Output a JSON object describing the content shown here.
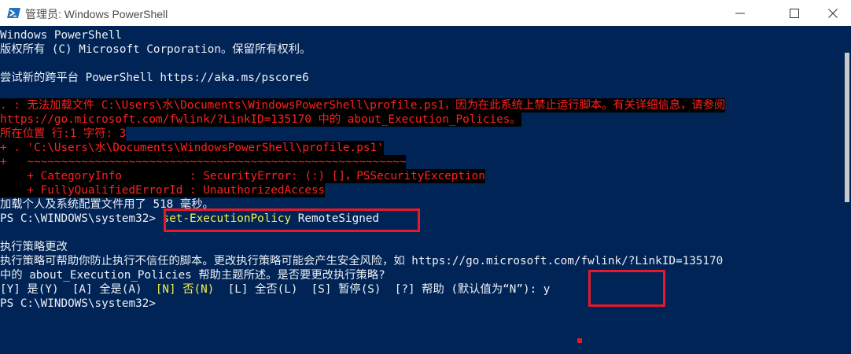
{
  "window": {
    "title": "管理员: Windows PowerShell"
  },
  "console": {
    "line1": "Windows PowerShell",
    "line2": "版权所有 (C) Microsoft Corporation。保留所有权利。",
    "line3": "尝试新的跨平台 PowerShell https://aka.ms/pscore6",
    "err1": ". : 无法加载文件 C:\\Users\\水\\Documents\\WindowsPowerShell\\profile.ps1，因为在此系统上禁止运行脚本。有关详细信息，请参阅",
    "err2": "https://go.microsoft.com/fwlink/?LinkID=135170 中的 about_Execution_Policies。",
    "err3": "所在位置 行:1 字符: 3",
    "err4": "+ . 'C:\\Users\\水\\Documents\\WindowsPowerShell\\profile.ps1'",
    "err5": "+   ~~~~~~~~~~~~~~~~~~~~~~~~~~~~~~~~~~~~~~~~~~~~~~~~~~~~~~~~",
    "err6": "    + CategoryInfo          : SecurityError: (:) []，PSSecurityException",
    "err7": "    + FullyQualifiedErrorId : UnauthorizedAccess",
    "line4": "加载个人及系统配置文件用了 518 毫秒。",
    "prompt1": "PS C:\\WINDOWS\\system32> ",
    "cmd_name": "set-ExecutionPolicy",
    "cmd_arg": " RemoteSigned",
    "line5": "执行策略更改",
    "line6": "执行策略可帮助你防止执行不信任的脚本。更改执行策略可能会产生安全风险，如 https://go.microsoft.com/fwlink/?LinkID=135170",
    "line7": "中的 about_Execution_Policies 帮助主题所述。是否要更改执行策略?",
    "choice_a": "[Y] 是(Y)  [A] 全是(A)  ",
    "choice_n": "[N] 否(N)",
    "choice_b": "  [L] 全否(L)  [S] 暂停(S)  [?] 帮助 (默认值为“N”): y",
    "prompt2": "PS C:\\WINDOWS\\system32>"
  },
  "colors": {
    "console_bg": "#012456",
    "error_text": "#ff2020",
    "highlight": "#f4f04a",
    "annotation": "#e6192b"
  },
  "icons": [
    "powershell-icon",
    "minimize-icon",
    "maximize-icon",
    "close-icon"
  ]
}
